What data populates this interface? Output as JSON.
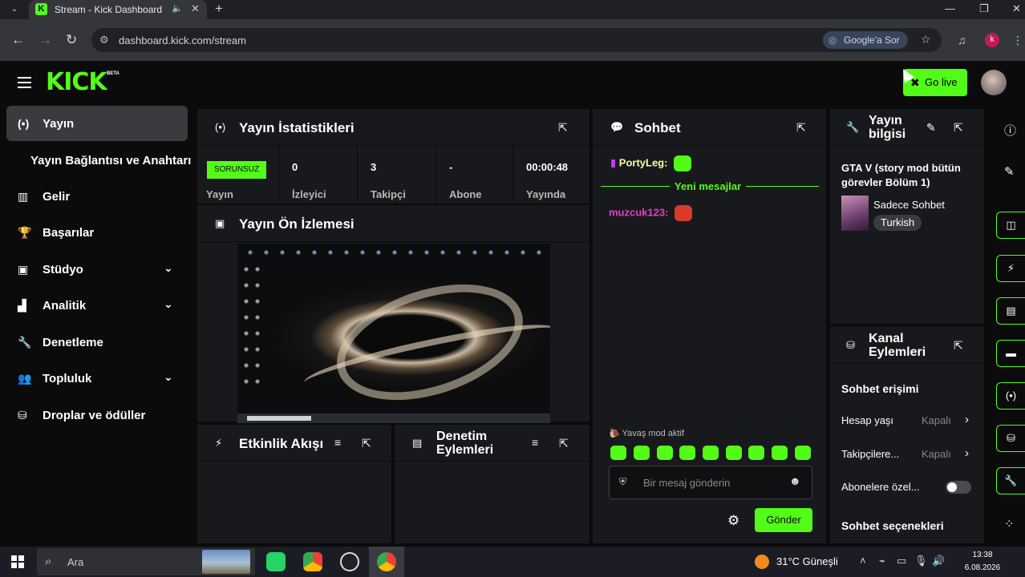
{
  "browser": {
    "tab_title": "Stream - Kick Dashboard",
    "url": "dashboard.kick.com/stream",
    "google_pill": "Google'a Sor",
    "profile_letter": "k"
  },
  "header": {
    "logo": "KICK",
    "beta": "BETA",
    "go_live": "Go live"
  },
  "sidebar": {
    "items": [
      {
        "label": "Yayın",
        "icon": "broadcast-icon"
      },
      {
        "label": "Yayın Bağlantısı ve Anahtarı",
        "icon": ""
      },
      {
        "label": "Gelir",
        "icon": "revenue-icon"
      },
      {
        "label": "Başarılar",
        "icon": "trophy-icon"
      },
      {
        "label": "Stüdyo",
        "icon": "studio-icon"
      },
      {
        "label": "Analitik",
        "icon": "analytics-icon"
      },
      {
        "label": "Denetleme",
        "icon": "wrench-icon"
      },
      {
        "label": "Topluluk",
        "icon": "community-icon"
      },
      {
        "label": "Droplar ve ödüller",
        "icon": "drops-icon"
      }
    ]
  },
  "stats": {
    "title": "Yayın İstatistikleri",
    "status_badge": "SORUNSUZ",
    "cells": [
      {
        "value": "",
        "label": "Yayın"
      },
      {
        "value": "0",
        "label": "İzleyici"
      },
      {
        "value": "3",
        "label": "Takipçi"
      },
      {
        "value": "-",
        "label": "Abone"
      },
      {
        "value": "00:00:48",
        "label": "Yayında"
      }
    ]
  },
  "preview": {
    "title": "Yayın Ön İzlemesi"
  },
  "activity": {
    "title": "Etkinlik Akışı"
  },
  "mod_actions": {
    "title_line1": "Denetim",
    "title_line2": "Eylemleri"
  },
  "chat": {
    "title": "Sohbet",
    "messages": [
      {
        "user": "PortyLeg:",
        "color": "#f7ff9b"
      },
      {
        "user": "muzcuk123:",
        "color": "#e040c8"
      }
    ],
    "new_messages": "Yeni mesajlar",
    "slow_mode": "Yavaş mod aktif",
    "input_placeholder": "Bir mesaj gönderin",
    "send": "Gönder"
  },
  "stream_info": {
    "title_line1": "Yayın",
    "title_line2": "bilgisi",
    "stream_title": "GTA V (story mod bütün görevler Bölüm 1)",
    "category": "Sadece Sohbet",
    "language": "Turkish"
  },
  "channel_actions": {
    "title_line1": "Kanal",
    "title_line2": "Eylemleri",
    "chat_access": "Sohbet erişimi",
    "rows": [
      {
        "label": "Hesap yaşı",
        "value": "Kapalı"
      },
      {
        "label": "Takipçilere...",
        "value": "Kapalı"
      },
      {
        "label": "Abonelere özel...",
        "value": ""
      }
    ],
    "chat_options": "Sohbet seçenekleri"
  },
  "taskbar": {
    "search": "Ara",
    "weather": "31°C  Güneşli",
    "time": "13:38",
    "date": "6.08.2026"
  },
  "colors": {
    "accent": "#53fc18",
    "panel": "#18191c",
    "bg": "#0b0b0c"
  }
}
